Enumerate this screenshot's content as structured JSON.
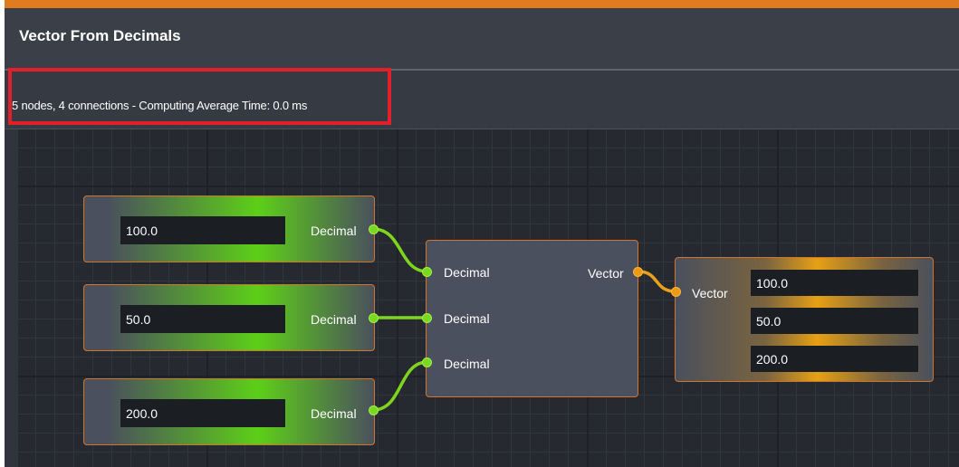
{
  "window": {
    "title": "Vector From Decimals"
  },
  "status": {
    "text": "5 nodes, 4 connections - Computing Average Time: 0.0 ms"
  },
  "nodes": {
    "decimal_1": {
      "value": "100.0",
      "output_label": "Decimal"
    },
    "decimal_2": {
      "value": "50.0",
      "output_label": "Decimal"
    },
    "decimal_3": {
      "value": "200.0",
      "output_label": "Decimal"
    },
    "combine": {
      "inputs": [
        "Decimal",
        "Decimal",
        "Decimal"
      ],
      "output_label": "Vector"
    },
    "vector_display": {
      "input_label": "Vector",
      "values": [
        "100.0",
        "50.0",
        "200.0"
      ]
    }
  },
  "colors": {
    "accent": "#e07c1e",
    "decimal_wire": "#7fd41e",
    "vector_wire": "#eaa11a",
    "highlight": "#e3202a"
  },
  "icons": [
    "connector-port"
  ]
}
